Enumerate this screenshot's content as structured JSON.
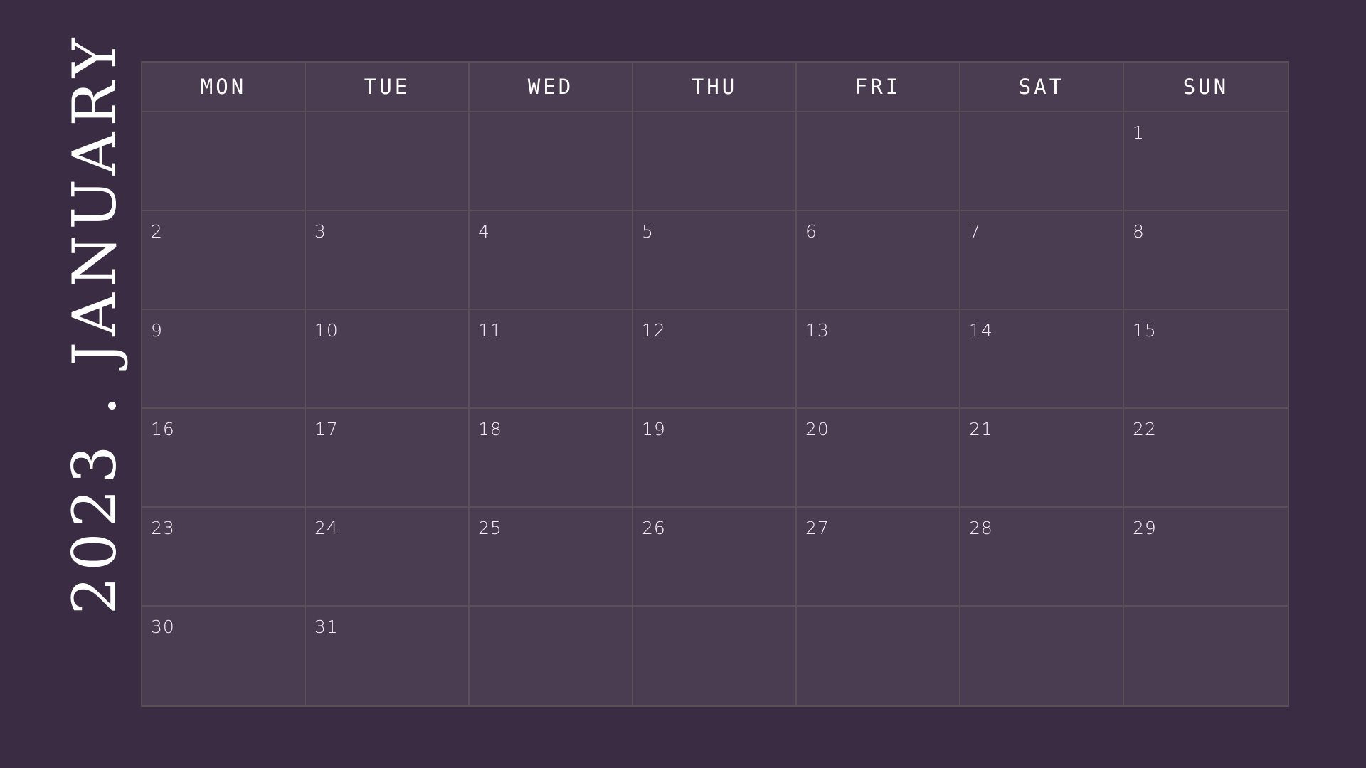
{
  "title": {
    "year": "2023",
    "separator": ".",
    "month": "JANUARY"
  },
  "weekdays": [
    "MON",
    "TUE",
    "WED",
    "THU",
    "FRI",
    "SAT",
    "SUN"
  ],
  "weeks": [
    [
      "",
      "",
      "",
      "",
      "",
      "",
      "1"
    ],
    [
      "2",
      "3",
      "4",
      "5",
      "6",
      "7",
      "8"
    ],
    [
      "9",
      "10",
      "11",
      "12",
      "13",
      "14",
      "15"
    ],
    [
      "16",
      "17",
      "18",
      "19",
      "20",
      "21",
      "22"
    ],
    [
      "23",
      "24",
      "25",
      "26",
      "27",
      "28",
      "29"
    ],
    [
      "30",
      "31",
      "",
      "",
      "",
      "",
      ""
    ]
  ],
  "colors": {
    "background": "#3a2c42",
    "grid_fill": "#4a3c51",
    "grid_line": "#5a5058",
    "text": "#ffffff"
  }
}
